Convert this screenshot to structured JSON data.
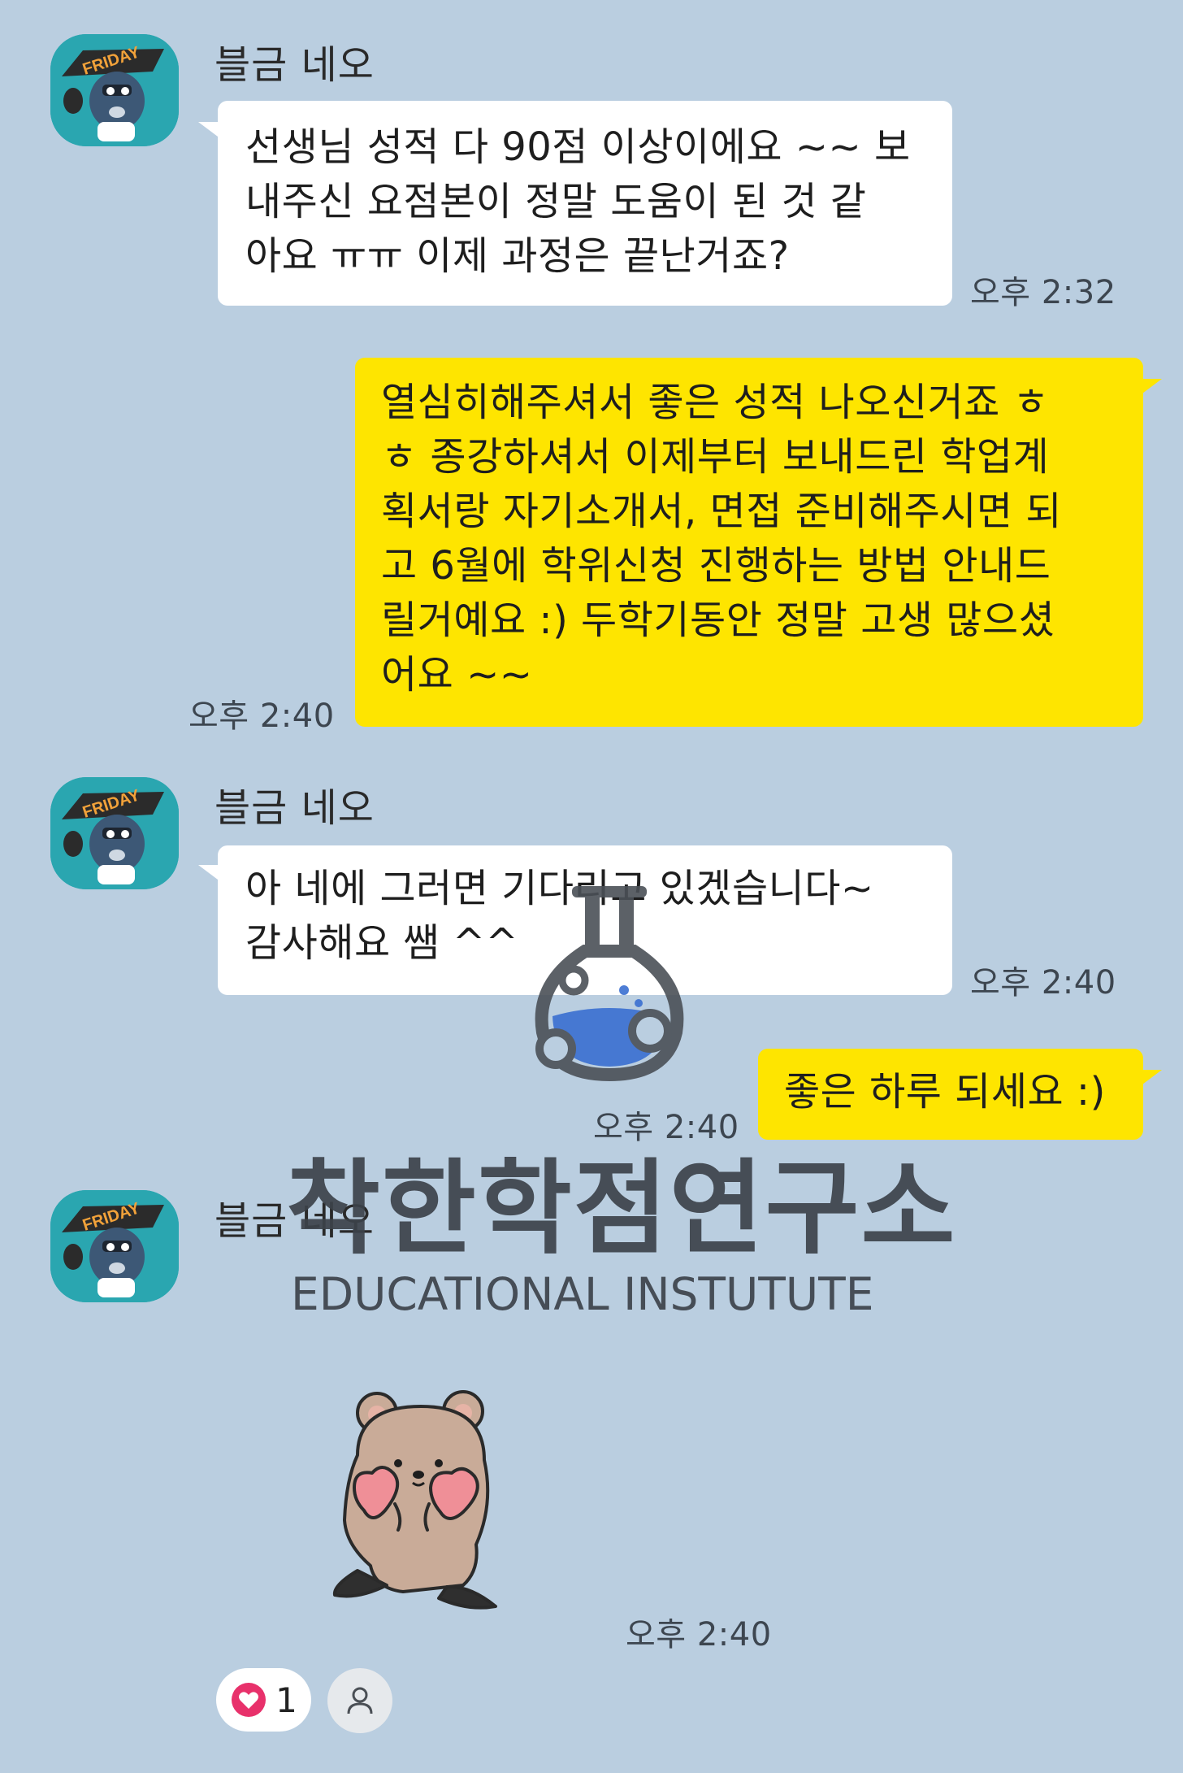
{
  "chat": {
    "messages": [
      {
        "sender": "블금 네오",
        "direction": "in",
        "text": "선생님 성적 다 90점 이상이에요 ~~ 보\n내주신 요점본이 정말 도움이 된 것 같\n아요 ㅠㅠ 이제 과정은 끝난거죠?",
        "time": "오후 2:32"
      },
      {
        "direction": "out",
        "text": "열심히해주셔서 좋은 성적 나오신거죠 ㅎ\nㅎ 종강하셔서 이제부터 보내드린 학업계\n획서랑 자기소개서, 면접 준비해주시면 되\n고 6월에 학위신청 진행하는 방법 안내드\n릴거예요 :) 두학기동안 정말 고생 많으셨\n어요 ~~",
        "time": "오후 2:40"
      },
      {
        "sender": "블금 네오",
        "direction": "in",
        "text": "아 네에 그러면 기다리고 있겠습니다~\n감사해요 쌤 ^^",
        "time": "오후 2:40"
      },
      {
        "direction": "out",
        "text": "좋은 하루 되세요 :)",
        "time": "오후 2:40"
      },
      {
        "sender": "블금 네오",
        "direction": "in",
        "type": "sticker",
        "sticker": "quokka-hearts-sticker",
        "time": "오후 2:40"
      }
    ],
    "reaction": {
      "icon": "heart-icon",
      "count": "1"
    },
    "add_reaction_icon": "person-icon"
  },
  "watermark": {
    "title": "착한학점연구소",
    "subtitle": "EDUCATIONAL INSTUTUTE"
  },
  "colors": {
    "background": "#bacee0",
    "incoming_bubble": "#ffffff",
    "outgoing_bubble": "#fee500",
    "avatar_bg": "#2aa6b0",
    "heart": "#e8316b",
    "watermark": "#3c424a"
  }
}
